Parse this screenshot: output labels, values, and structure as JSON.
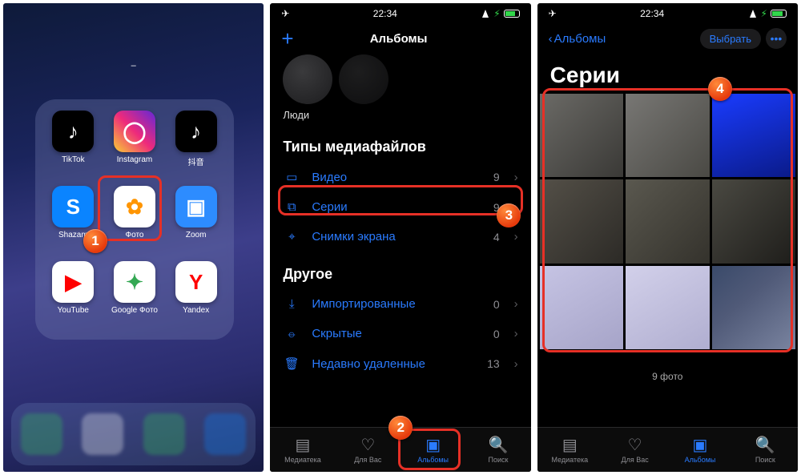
{
  "status_time": "22:34",
  "panel1": {
    "folder_title": "–",
    "apps": [
      {
        "label": "TikTok",
        "bg": "#000",
        "glyph": "♪",
        "glyphColor": "#fff"
      },
      {
        "label": "Instagram",
        "bg": "linear-gradient(45deg,#f9ce34,#ee2a7b,#6228d7)",
        "glyph": "◯",
        "glyphColor": "#fff"
      },
      {
        "label": "抖音",
        "bg": "#000",
        "glyph": "♪",
        "glyphColor": "#fff"
      },
      {
        "label": "Shazam",
        "bg": "#0a84ff",
        "glyph": "S",
        "glyphColor": "#fff"
      },
      {
        "label": "Фото",
        "bg": "#fff",
        "glyph": "✿",
        "glyphColor": "#ff9500"
      },
      {
        "label": "Zoom",
        "bg": "#2d8cff",
        "glyph": "▣",
        "glyphColor": "#fff"
      },
      {
        "label": "YouTube",
        "bg": "#fff",
        "glyph": "▶",
        "glyphColor": "#ff0000"
      },
      {
        "label": "Google Фото",
        "bg": "#fff",
        "glyph": "✦",
        "glyphColor": "#34a853"
      },
      {
        "label": "Yandex",
        "bg": "#fff",
        "glyph": "Y",
        "glyphColor": "#ff0000"
      }
    ],
    "dock_colors": [
      "#34c759",
      "#fff",
      "#34c759",
      "#0a84ff"
    ]
  },
  "panel2": {
    "nav_title": "Альбомы",
    "people_label": "Люди",
    "section_media_types": "Типы медиафайлов",
    "media_rows": [
      {
        "icon": "▭",
        "label": "Видео",
        "count": "9"
      },
      {
        "icon": "⧉",
        "label": "Серии",
        "count": "9"
      },
      {
        "icon": "⌖",
        "label": "Снимки экрана",
        "count": "4"
      }
    ],
    "section_other": "Другое",
    "other_rows": [
      {
        "icon": "⤓",
        "label": "Импортированные",
        "count": "0"
      },
      {
        "icon": "⦵",
        "label": "Скрытые",
        "count": "0"
      },
      {
        "icon": "🗑",
        "label": "Недавно удаленные",
        "count": "13"
      }
    ],
    "tabs": [
      {
        "label": "Медиатека"
      },
      {
        "label": "Для Вас"
      },
      {
        "label": "Альбомы"
      },
      {
        "label": "Поиск"
      }
    ]
  },
  "panel3": {
    "back_label": "Альбомы",
    "select_label": "Выбрать",
    "title": "Серии",
    "footer": "9 фото",
    "cell_bg": [
      "linear-gradient(135deg,#6b6a66,#3a3936)",
      "linear-gradient(135deg,#787774,#4a4944)",
      "linear-gradient(160deg,#1a3cff,#0a1a88)",
      "linear-gradient(135deg,#545048,#2c2a26)",
      "linear-gradient(135deg,#5a584f,#34322c)",
      "linear-gradient(135deg,#4a4942,#1e1d1a)",
      "linear-gradient(150deg,#c6c4e4,#a6a4c8)",
      "linear-gradient(150deg,#d2d0ea,#b0aed0)",
      "linear-gradient(140deg,#3a4a6a,#505a78 40%,#7a84a0)"
    ],
    "tabs": [
      {
        "label": "Медиатека"
      },
      {
        "label": "Для Вас"
      },
      {
        "label": "Альбомы"
      },
      {
        "label": "Поиск"
      }
    ]
  },
  "badges": [
    "1",
    "2",
    "3",
    "4"
  ]
}
